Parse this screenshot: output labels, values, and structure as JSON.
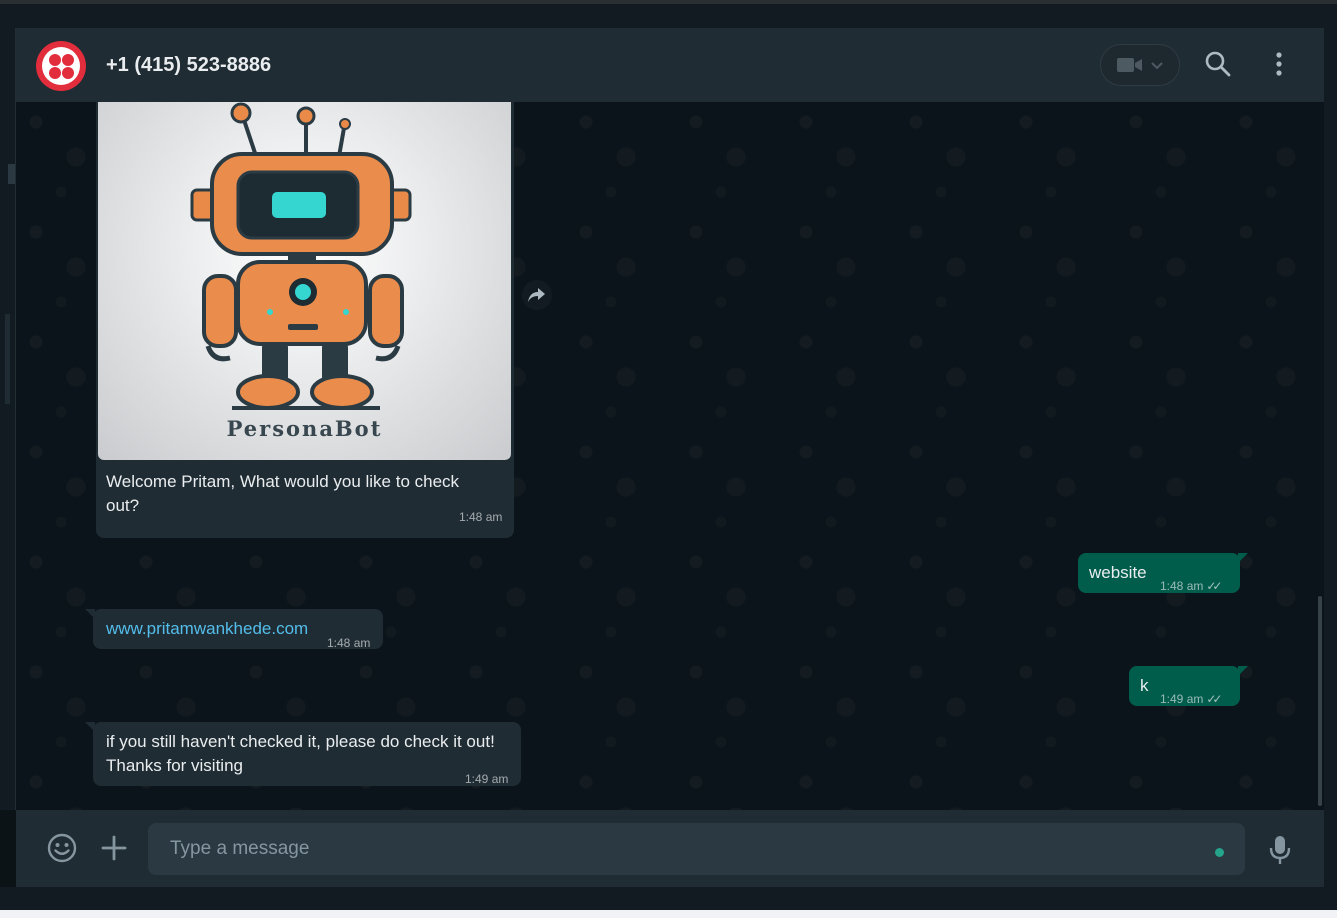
{
  "header": {
    "contact": "+1 (415) 523-8886",
    "icons": {
      "avatar": "twilio-logo",
      "video": "video-camera-icon",
      "search": "search-icon",
      "menu": "vertical-dots-icon"
    }
  },
  "messages": {
    "image_caption_logo": "PersonaBot",
    "welcome": {
      "text": "Welcome Pritam, What would you like to check out?",
      "time": "1:48 am"
    },
    "website": {
      "text": "website",
      "time": "1:48 am"
    },
    "link": {
      "text": "www.pritamwankhede.com",
      "time": "1:48 am"
    },
    "k": {
      "text": "k",
      "time": "1:49 am"
    },
    "reminder": {
      "line1": "if you still haven't checked it, please do check it out!",
      "line2": "Thanks for visiting",
      "time": "1:49 am"
    }
  },
  "composer": {
    "placeholder": "Type a message"
  },
  "colors": {
    "incoming": "#202c33",
    "outgoing": "#005c4b",
    "link": "#53bdeb",
    "background": "#0b141a"
  }
}
